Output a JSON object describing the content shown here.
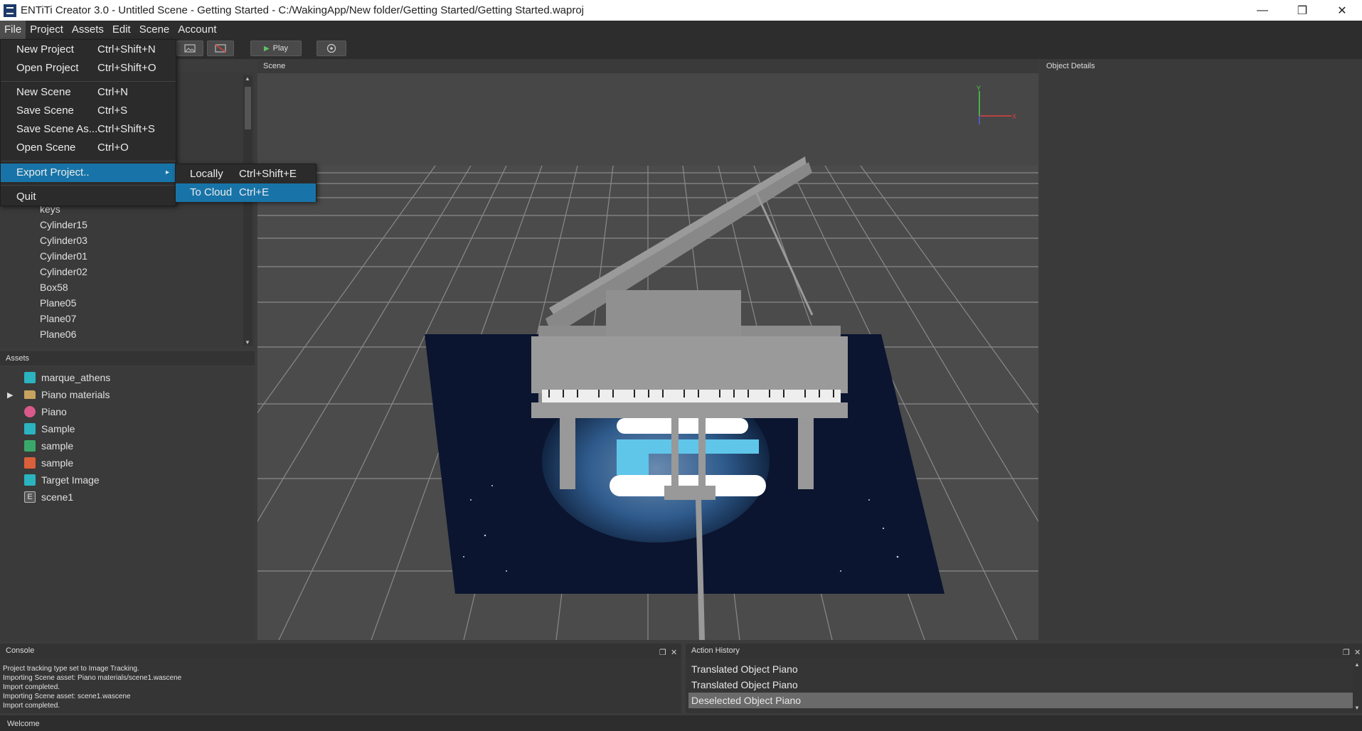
{
  "window": {
    "title": "ENTiTi Creator 3.0 - Untitled Scene - Getting Started - C:/WakingApp/New folder/Getting Started/Getting Started.waproj",
    "minimize": "—",
    "maximize": "❐",
    "close": "✕"
  },
  "menubar": [
    "File",
    "Project",
    "Assets",
    "Edit",
    "Scene",
    "Account"
  ],
  "toolbar": {
    "play_label": "Play"
  },
  "file_menu": {
    "items": [
      {
        "label": "New Project",
        "shortcut": "Ctrl+Shift+N"
      },
      {
        "label": "Open Project",
        "shortcut": "Ctrl+Shift+O"
      },
      {
        "label": "New Scene",
        "shortcut": "Ctrl+N"
      },
      {
        "label": "Save Scene",
        "shortcut": "Ctrl+S"
      },
      {
        "label": "Save Scene As...",
        "shortcut": "Ctrl+Shift+S"
      },
      {
        "label": "Open Scene",
        "shortcut": "Ctrl+O"
      },
      {
        "label": "Export Project..",
        "shortcut": "▸"
      },
      {
        "label": "Quit",
        "shortcut": ""
      }
    ]
  },
  "export_submenu": {
    "items": [
      {
        "label": "Locally",
        "shortcut": "Ctrl+Shift+E"
      },
      {
        "label": "To Cloud",
        "shortcut": "Ctrl+E"
      }
    ]
  },
  "hierarchy": {
    "items": [
      "keys",
      "Cylinder15",
      "Cylinder03",
      "Cylinder01",
      "Cylinder02",
      "Box58",
      "Plane05",
      "Plane07",
      "Plane06"
    ]
  },
  "assets": {
    "title": "Assets",
    "items": [
      {
        "label": "marque_athens",
        "icon": "image-icon",
        "color": "#2bb3c0"
      },
      {
        "label": "Piano materials",
        "icon": "folder-icon",
        "color": "#c8a25e"
      },
      {
        "label": "Piano",
        "icon": "model-icon",
        "color": "#d95a8a"
      },
      {
        "label": "Sample",
        "icon": "image-icon",
        "color": "#2bb3c0"
      },
      {
        "label": "sample",
        "icon": "audio-icon",
        "color": "#3aa86a"
      },
      {
        "label": "sample",
        "icon": "video-icon",
        "color": "#d9603a"
      },
      {
        "label": "Target Image",
        "icon": "image-icon",
        "color": "#2bb3c0"
      },
      {
        "label": "scene1",
        "icon": "scene-file-icon",
        "color": "#bbbbbb"
      }
    ]
  },
  "scene": {
    "title": "Scene"
  },
  "object_details": {
    "title": "Object Details"
  },
  "console": {
    "title": "Console",
    "lines": [
      "Project tracking type set to Image Tracking.",
      "Importing Scene asset: Piano materials/scene1.wascene",
      "Import completed.",
      "Importing Scene asset: scene1.wascene",
      "Import completed."
    ]
  },
  "action_history": {
    "title": "Action History",
    "items": [
      "Translated Object Piano",
      "Translated Object Piano",
      "Deselected Object Piano"
    ]
  },
  "status": "Welcome",
  "gizmo": {
    "y": "Y",
    "x": "X"
  },
  "colors": {
    "highlight": "#1874a8",
    "panel": "#3a3a3a"
  }
}
